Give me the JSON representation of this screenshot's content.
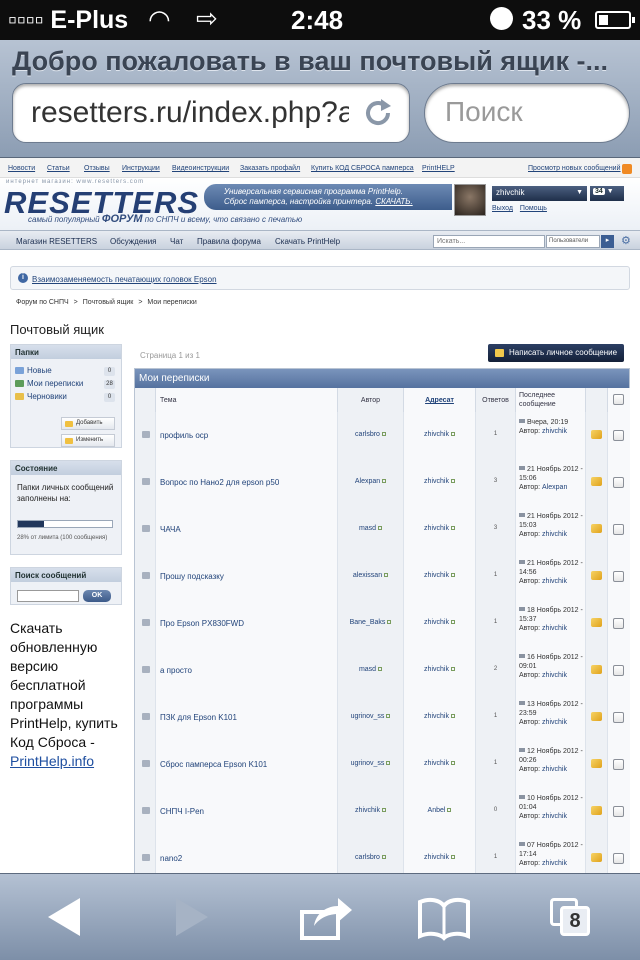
{
  "status_bar": {
    "carrier": "▫▫▫▫ E-Plus",
    "time": "2:48",
    "battery": "33 %"
  },
  "browser": {
    "page_title": "Добро пожаловать в ваш почтовый ящик -...",
    "url": "resetters.ru/index.php?a",
    "search_placeholder": "Поиск",
    "tab_count": "8"
  },
  "top_links": {
    "items": [
      "Новости",
      "Статьи",
      "Отзывы",
      "Инструкции",
      "Видеоинструкции",
      "Заказать профайл",
      "Купить КОД СБРОСА памперса",
      "PrintHELP"
    ],
    "right": "Просмотр новых сообщений"
  },
  "banner": {
    "tagline_top": "интернет магазин: www.resetters.com",
    "logo": "RESETTERS",
    "logo_sub_before": "самый популярный",
    "logo_sub_forum": "ФОРУМ",
    "logo_sub_after": "по СНПЧ и всему, что связано с печатью",
    "promo_line1": "Универсальная сервисная программа PrintHelp.",
    "promo_line2": "Сброс памперса, настройка принтера.",
    "promo_link": "СКАЧАТЬ."
  },
  "user": {
    "name": "zhivchik",
    "messages": "34",
    "logout": "Выход",
    "help": "Помощь"
  },
  "main_nav": {
    "items": [
      "Магазин RESETTERS",
      "Обсуждения",
      "Чат",
      "Правила форума",
      "Скачать PrintHelp"
    ],
    "search_placeholder": "Искать...",
    "search_scope": "Пользователи"
  },
  "announcement": "Взаимозаменяемость печатающих головок Epson",
  "breadcrumb": [
    "Форум по СНПЧ",
    ">",
    "Почтовый ящик",
    ">",
    "Мои переписки"
  ],
  "page_title": "Почтовый ящик",
  "folders": {
    "title": "Папки",
    "items": [
      {
        "label": "Новые",
        "count": "0"
      },
      {
        "label": "Мои переписки",
        "count": "28"
      },
      {
        "label": "Черновики",
        "count": "0"
      }
    ],
    "add": "Добавить",
    "edit": "Изменить"
  },
  "state": {
    "title": "Состояние",
    "text": "Папки личных сообщений заполнены на:",
    "usage_percent": 28,
    "usage_text": "28% от лимита (100 сообщения)"
  },
  "msg_search": {
    "title": "Поиск сообщений",
    "button": "OK"
  },
  "sidebar_ad": {
    "text": "Скачать обновленную версию бесплатной программы PrintHelp, купить Код Сброса - ",
    "link": "PrintHelp.info"
  },
  "pagination": "Страница 1 из 1",
  "compose_button": "Написать личное сообщение",
  "inbox": {
    "title": "Мои переписки",
    "columns": {
      "topic": "Тема",
      "author": "Автор",
      "recipient": "Адресат",
      "replies": "Ответов",
      "last": "Последнее сообщение"
    },
    "rows": [
      {
        "topic": "профиль оср",
        "author": "carlsbro",
        "to": "zhivchik",
        "replies": "1",
        "last_date": "Вчера, 20:19",
        "last_by": "zhivchik"
      },
      {
        "topic": "Вопрос по Нано2 для epson p50",
        "author": "Alexpan",
        "to": "zhivchik",
        "replies": "3",
        "last_date": "21 Ноябрь 2012 - 15:06",
        "last_by": "Alexpan"
      },
      {
        "topic": "ЧАЧА",
        "author": "masd",
        "to": "zhivchik",
        "replies": "3",
        "last_date": "21 Ноябрь 2012 - 15:03",
        "last_by": "zhivchik"
      },
      {
        "topic": "Прошу подсказку",
        "author": "alexissan",
        "to": "zhivchik",
        "replies": "1",
        "last_date": "21 Ноябрь 2012 - 14:56",
        "last_by": "zhivchik"
      },
      {
        "topic": "Про Epson PX830FWD",
        "author": "Bane_Baks",
        "to": "zhivchik",
        "replies": "1",
        "last_date": "18 Ноябрь 2012 - 15:37",
        "last_by": "zhivchik"
      },
      {
        "topic": "а просто",
        "author": "masd",
        "to": "zhivchik",
        "replies": "2",
        "last_date": "16 Ноябрь 2012 - 09:01",
        "last_by": "zhivchik"
      },
      {
        "topic": "ПЗК для Epson K101",
        "author": "ugrinov_ss",
        "to": "zhivchik",
        "replies": "1",
        "last_date": "13 Ноябрь 2012 - 23:59",
        "last_by": "zhivchik"
      },
      {
        "topic": "Сброс памперса Epson K101",
        "author": "ugrinov_ss",
        "to": "zhivchik",
        "replies": "1",
        "last_date": "12 Ноябрь 2012 - 00:26",
        "last_by": "zhivchik"
      },
      {
        "topic": "СНПЧ I-Pen",
        "author": "zhivchik",
        "to": "Anbel",
        "replies": "0",
        "last_date": "10 Ноябрь 2012 - 01:04",
        "last_by": "zhivchik"
      },
      {
        "topic": "nano2",
        "author": "carlsbro",
        "to": "zhivchik",
        "replies": "1",
        "last_date": "07 Ноябрь 2012 - 17:14",
        "last_by": "zhivchik"
      }
    ]
  },
  "toolbar_labels": {
    "author_prefix": "Автор:"
  }
}
